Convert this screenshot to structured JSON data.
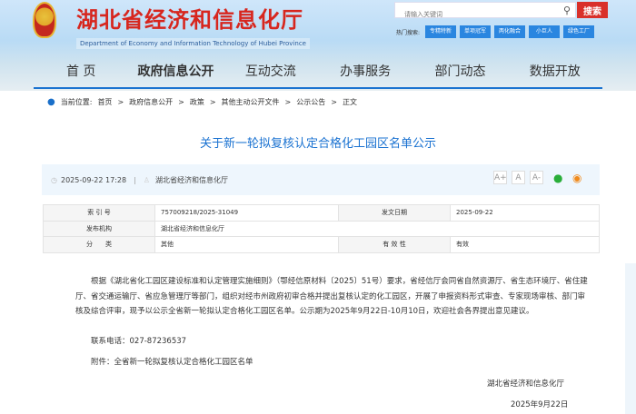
{
  "header": {
    "title": "湖北省经济和信息化厅",
    "subtitle": "Department of Economy and Information Technology of Hubei Province",
    "search_placeholder": "请输入关键词",
    "search_button": "搜索",
    "hot_label": "热门搜索:",
    "hot_tags": [
      "专精特新",
      "单项冠军",
      "两化融合",
      "小巨人",
      "绿色工厂"
    ]
  },
  "nav": [
    "首 页",
    "政府信息公开",
    "互动交流",
    "办事服务",
    "部门动态",
    "数据开放"
  ],
  "breadcrumb": {
    "label": "当前位置:",
    "items": [
      "首页",
      "政府信息公开",
      "政策",
      "其他主动公开文件",
      "公示公告",
      "正文"
    ],
    "sep": ">"
  },
  "article": {
    "title": "关于新一轮拟复核认定合格化工园区名单公示",
    "datetime": "2025-09-22 17:28",
    "source": "湖北省经济和信息化厅",
    "font_sizes": [
      "A+",
      "A",
      "A-"
    ]
  },
  "info": {
    "index_label": "索 引 号",
    "index": "757009218/2025-31049",
    "date_label": "发文日期",
    "date": "2025-09-22",
    "publisher_label": "发布机构",
    "publisher": "湖北省经济和信息化厅",
    "category_label": "分　　类",
    "category": "其他",
    "validity_label": "有 效 性",
    "validity": "有效"
  },
  "body": {
    "paragraph": "根据《湖北省化工园区建设标准和认定管理实施细则》（鄂经信原材料〔2025〕51号）要求，省经信厅会同省自然资源厅、省生态环境厅、省住建厅、省交通运输厅、省应急管理厅等部门，组织对经市州政府初审合格并提出复核认定的化工园区，开展了申报资料形式审查、专家现场审核、部门审核及综合评审，现予以公示全省新一轮拟认定合格化工园区名单。公示期为2025年9月22日-10月10日，欢迎社会各界提出意见建议。",
    "phone": "联系电话：027-87236537",
    "attachment": "附件：全省新一轮拟复核认定合格化工园区名单",
    "signature": "湖北省经济和信息化厅",
    "sign_date": "2025年9月22日"
  }
}
